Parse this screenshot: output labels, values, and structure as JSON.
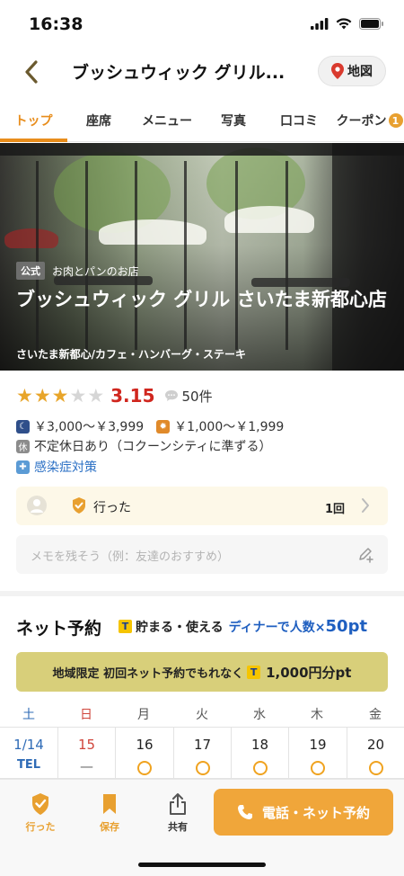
{
  "status": {
    "time": "16:38"
  },
  "header": {
    "title": "ブッシュウィック グリル...",
    "map_label": "地図"
  },
  "tabs": [
    {
      "label": "トップ",
      "active": true
    },
    {
      "label": "座席"
    },
    {
      "label": "メニュー"
    },
    {
      "label": "写真"
    },
    {
      "label": "口コミ"
    },
    {
      "label": "クーポン",
      "badge": "1"
    }
  ],
  "hero": {
    "official_badge": "公式",
    "tagline": "お肉とパンのお店",
    "name": "ブッシュウィック グリル さいたま新都心店",
    "area_genre": "さいたま新都心/カフェ・ハンバーグ・ステーキ"
  },
  "rating": {
    "score": "3.15",
    "stars": 3,
    "max_stars": 5,
    "review_count": "50件"
  },
  "info": {
    "dinner_price": "￥3,000～￥3,999",
    "lunch_price": "￥1,000～￥1,999",
    "holiday_badge": "休",
    "holiday": "不定休日あり（コクーンシティに準ずる）",
    "infection_control": "感染症対策"
  },
  "visited": {
    "label": "行った",
    "count": "1回"
  },
  "memo": {
    "placeholder": "メモを残そう（例：友達のおすすめ）"
  },
  "reservation": {
    "title": "ネット予約",
    "t_mark": "T",
    "promo_earn": "貯まる・使える",
    "promo_dinner": "ディナーで人数×",
    "promo_points": "50pt",
    "banner_text": "地域限定 初回ネット予約でもれなく",
    "banner_amount": "1,000円分pt"
  },
  "calendar": {
    "weekdays": [
      "土",
      "日",
      "月",
      "火",
      "水",
      "木",
      "金"
    ],
    "days": [
      {
        "date": "1/14",
        "status": "TEL"
      },
      {
        "date": "15",
        "status": "—"
      },
      {
        "date": "16",
        "status": "○"
      },
      {
        "date": "17",
        "status": "○"
      },
      {
        "date": "18",
        "status": "○"
      },
      {
        "date": "19",
        "status": "○"
      },
      {
        "date": "20",
        "status": "○"
      }
    ]
  },
  "bottom_bar": {
    "visited_label": "行った",
    "save_label": "保存",
    "share_label": "共有",
    "call_label": "電話・ネット予約"
  },
  "colors": {
    "accent": "#e88d1c",
    "score_red": "#d0261e",
    "link_blue": "#2a6fc4",
    "cta_orange": "#f0a63a"
  }
}
